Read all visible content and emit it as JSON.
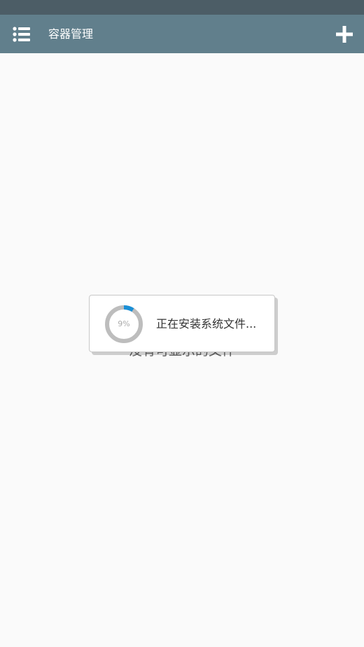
{
  "app_bar": {
    "title": "容器管理",
    "menu_icon": "list-icon",
    "add_icon": "plus-icon"
  },
  "content": {
    "empty_text": "没有可显示的文件"
  },
  "progress_dialog": {
    "progress_percent": 9,
    "progress_label": "9%",
    "message": "正在安装系统文件..."
  },
  "colors": {
    "status_bar": "#4c5d66",
    "app_bar": "#617f8c",
    "progress_accent": "#1a8fd6",
    "progress_track": "#bdbdbd"
  }
}
